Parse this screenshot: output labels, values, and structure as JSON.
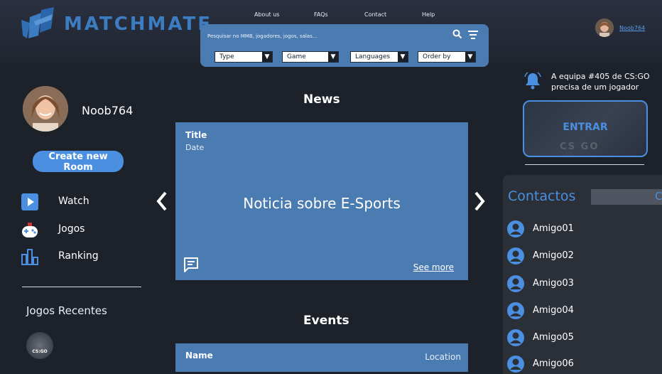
{
  "brand": {
    "name": "MATCHMATE"
  },
  "topnav": [
    "About us",
    "FAQs",
    "Contact",
    "Help"
  ],
  "search": {
    "placeholder": "Pesquisar no MMB, jogadores, jogos, salas...",
    "filters": [
      "Type",
      "Game",
      "Languages",
      "Order by"
    ]
  },
  "user": {
    "username": "Noob764"
  },
  "sidebar": {
    "create_label": "Create new Room",
    "items": [
      {
        "label": "Watch",
        "icon": "play-icon"
      },
      {
        "label": "Jogos",
        "icon": "gamepad-icon"
      },
      {
        "label": "Ranking",
        "icon": "ranking-icon"
      }
    ],
    "recent_title": "Jogos Recentes",
    "recent_badge": "CS:GO"
  },
  "news": {
    "section_title": "News",
    "card_title": "Title",
    "card_date": "Date",
    "card_body": "Noticia sobre E-Sports",
    "see_more": "See more"
  },
  "events": {
    "section_title": "Events",
    "card_name": "Name",
    "card_location": "Location"
  },
  "notification": {
    "text": "A equipa #405 de CS:GO precisa de um jogador",
    "cta": "ENTRAR",
    "game_tag": "CS GO"
  },
  "contacts": {
    "title": "Contactos",
    "search_letter": "C",
    "list": [
      "Amigo01",
      "Amigo02",
      "Amigo03",
      "Amigo04",
      "Amigo05",
      "Amigo06"
    ]
  },
  "colors": {
    "accent": "#4a8fe0",
    "card": "#4a7bb1",
    "bg": "#1d2129"
  }
}
